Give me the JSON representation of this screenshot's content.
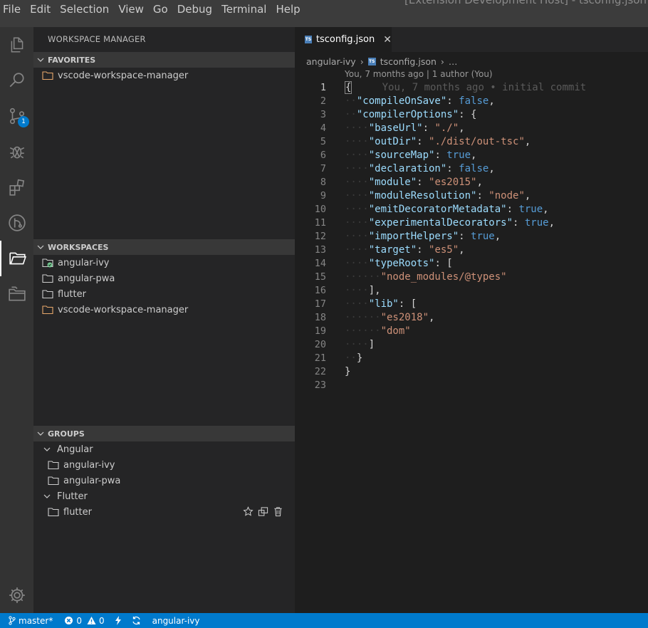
{
  "window_title": "[Extension Development Host] - tsconfig.json",
  "menu": [
    "File",
    "Edit",
    "Selection",
    "View",
    "Go",
    "Debug",
    "Terminal",
    "Help"
  ],
  "activity": {
    "scm_badge": "1"
  },
  "sidebar": {
    "title": "WORKSPACE MANAGER",
    "favorites": {
      "header": "FAVORITES",
      "items": [
        {
          "label": "vscode-workspace-manager",
          "icon": "folder-orange-icon"
        }
      ]
    },
    "workspaces": {
      "header": "WORKSPACES",
      "items": [
        {
          "label": "angular-ivy",
          "icon": "folder-active-icon"
        },
        {
          "label": "angular-pwa",
          "icon": "folder-icon"
        },
        {
          "label": "flutter",
          "icon": "folder-icon"
        },
        {
          "label": "vscode-workspace-manager",
          "icon": "folder-orange-icon"
        }
      ]
    },
    "groups": {
      "header": "GROUPS",
      "groups": [
        {
          "label": "Angular",
          "items": [
            "angular-ivy",
            "angular-pwa"
          ]
        },
        {
          "label": "Flutter",
          "items": [
            "flutter"
          ]
        }
      ]
    }
  },
  "editor": {
    "tab_label": "tsconfig.json",
    "tab_icon": "TS",
    "breadcrumbs": [
      "angular-ivy",
      "tsconfig.json",
      "…"
    ],
    "codelens": "You, 7 months ago | 1 author (You)",
    "blame": "You, 7 months ago • initial commit",
    "lines": [
      "1",
      "2",
      "3",
      "4",
      "5",
      "6",
      "7",
      "8",
      "9",
      "10",
      "11",
      "12",
      "13",
      "14",
      "15",
      "16",
      "17",
      "18",
      "19",
      "20",
      "21",
      "22",
      "23"
    ],
    "code": {
      "compileOnSave_key": "\"compileOnSave\"",
      "compileOnSave_val": "false",
      "compilerOptions_key": "\"compilerOptions\"",
      "baseUrl_key": "\"baseUrl\"",
      "baseUrl_val": "\"./\"",
      "outDir_key": "\"outDir\"",
      "outDir_val": "\"./dist/out-tsc\"",
      "sourceMap_key": "\"sourceMap\"",
      "sourceMap_val": "true",
      "declaration_key": "\"declaration\"",
      "declaration_val": "false",
      "module_key": "\"module\"",
      "module_val": "\"es2015\"",
      "moduleResolution_key": "\"moduleResolution\"",
      "moduleResolution_val": "\"node\"",
      "emitDecoratorMetadata_key": "\"emitDecoratorMetadata\"",
      "emitDecoratorMetadata_val": "true",
      "experimentalDecorators_key": "\"experimentalDecorators\"",
      "experimentalDecorators_val": "true",
      "importHelpers_key": "\"importHelpers\"",
      "importHelpers_val": "true",
      "target_key": "\"target\"",
      "target_val": "\"es5\"",
      "typeRoots_key": "\"typeRoots\"",
      "typeRoots_item": "\"node_modules/@types\"",
      "lib_key": "\"lib\"",
      "lib_item1": "\"es2018\"",
      "lib_item2": "\"dom\""
    }
  },
  "status": {
    "branch": "master*",
    "errors": "0",
    "warnings": "0",
    "workspace": "angular-ivy"
  }
}
